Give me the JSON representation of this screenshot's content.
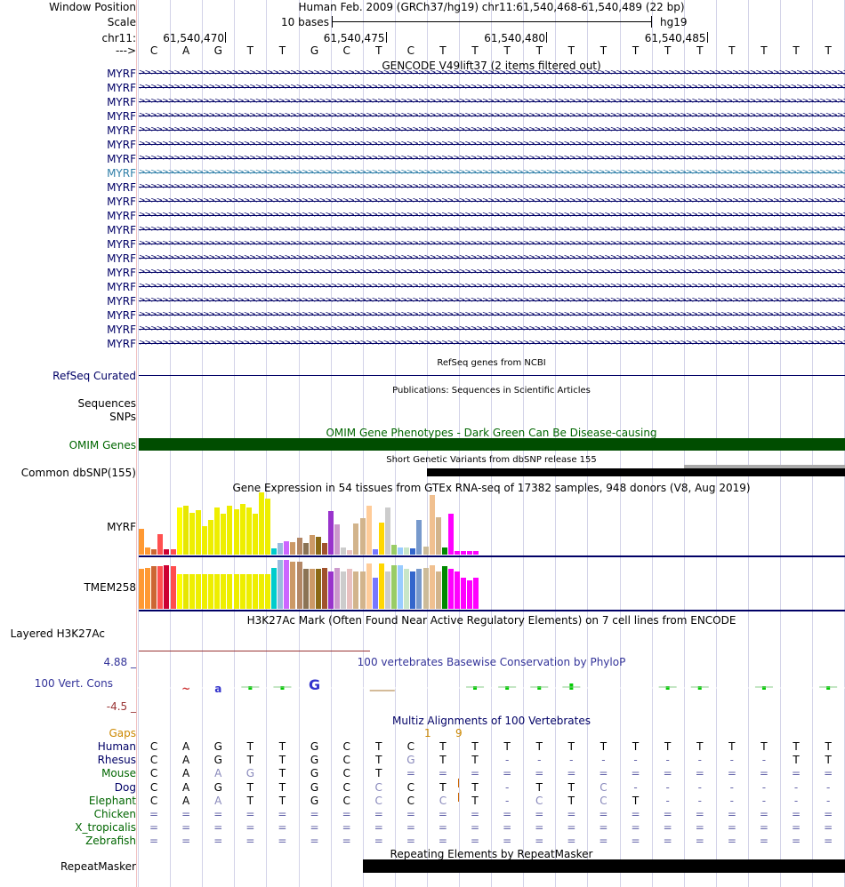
{
  "header": {
    "window_position_label": "Window Position",
    "scale_label": "Scale",
    "chrom_label": "chr11:",
    "strand_label": "--->",
    "assembly_title": "Human Feb. 2009 (GRCh37/hg19)   chr11:61,540,468-61,540,489 (22 bp)",
    "scale_text": "10 bases",
    "scale_assembly": "hg19",
    "ruler_positions": [
      "61,540,470",
      "61,540,475",
      "61,540,480",
      "61,540,485"
    ]
  },
  "sequence": [
    "C",
    "A",
    "G",
    "T",
    "T",
    "G",
    "C",
    "T",
    "C",
    "T",
    "T",
    "T",
    "T",
    "T",
    "T",
    "T",
    "T",
    "T",
    "T",
    "T",
    "T",
    "T"
  ],
  "gencode": {
    "title": "GENCODE V49lift37 (2 items filtered out)",
    "rows": [
      "MYRF",
      "MYRF",
      "MYRF",
      "MYRF",
      "MYRF",
      "MYRF",
      "MYRF",
      "MYRF",
      "MYRF",
      "MYRF",
      "MYRF",
      "MYRF",
      "MYRF",
      "MYRF",
      "MYRF",
      "MYRF",
      "MYRF",
      "MYRF",
      "MYRF",
      "MYRF"
    ],
    "highlight_index": 7
  },
  "refseq": {
    "title": "RefSeq genes from NCBI",
    "label": "RefSeq Curated"
  },
  "publications": {
    "title": "Publications: Sequences in Scientific Articles",
    "label1": "Sequences",
    "label2": "SNPs"
  },
  "omim": {
    "title": "OMIM Gene Phenotypes - Dark Green Can Be Disease-causing",
    "label": "OMIM Genes",
    "color": "#004d00"
  },
  "dbsnp": {
    "title": "Short Genetic Variants from dbSNP release 155",
    "label": "Common dbSNP(155)"
  },
  "gtex": {
    "title": "Gene Expression in 54 tissues from GTEx RNA-seq of 17382 samples, 948 donors (V8, Aug 2019)",
    "genes": [
      {
        "name": "MYRF",
        "values": [
          0.42,
          0.12,
          0.08,
          0.33,
          0.08,
          0.08,
          0.75,
          0.78,
          0.67,
          0.72,
          0.45,
          0.55,
          0.76,
          0.65,
          0.78,
          0.73,
          0.82,
          0.75,
          0.66,
          1.0,
          0.9,
          0.1,
          0.18,
          0.22,
          0.2,
          0.27,
          0.18,
          0.32,
          0.28,
          0.18,
          0.7,
          0.48,
          0.12,
          0.07,
          0.5,
          0.58,
          0.78,
          0.08,
          0.52,
          0.75,
          0.15,
          0.12,
          0.12,
          0.1,
          0.55,
          0.13,
          0.95,
          0.6,
          0.12,
          0.65,
          0.05,
          0.05,
          0.05,
          0.05
        ]
      },
      {
        "name": "TMEM258",
        "values": [
          0.78,
          0.8,
          0.82,
          0.82,
          0.85,
          0.82,
          0.68,
          0.68,
          0.68,
          0.68,
          0.68,
          0.68,
          0.68,
          0.68,
          0.68,
          0.68,
          0.68,
          0.68,
          0.68,
          0.68,
          0.68,
          0.8,
          0.95,
          0.95,
          0.92,
          0.92,
          0.78,
          0.78,
          0.78,
          0.8,
          0.72,
          0.8,
          0.72,
          0.78,
          0.72,
          0.72,
          0.88,
          0.6,
          0.88,
          0.72,
          0.85,
          0.85,
          0.78,
          0.72,
          0.78,
          0.8,
          0.85,
          0.72,
          0.82,
          0.78,
          0.72,
          0.6,
          0.55,
          0.6
        ]
      }
    ],
    "colors": [
      "#ff9933",
      "#ff9933",
      "#cc6633",
      "#ff5050",
      "#cc0033",
      "#ff4d4d",
      "#ffff00",
      "#e6e600",
      "#eeee00",
      "#eeee00",
      "#eeee00",
      "#eeee00",
      "#eeee00",
      "#eeee00",
      "#eeee00",
      "#eeee00",
      "#eeee00",
      "#eeee00",
      "#eeee00",
      "#eeee00",
      "#eeee00",
      "#00cccc",
      "#99bbdd",
      "#cc66ff",
      "#cc9966",
      "#b38766",
      "#8b7355",
      "#cc9966",
      "#8b6914",
      "#a0522d",
      "#9933cc",
      "#cc99cc",
      "#cccccc",
      "#e8c0c0",
      "#d2b48c",
      "#d2b48c",
      "#ffcc99",
      "#7777ff",
      "#ffd700",
      "#cccccc",
      "#99cc66",
      "#99ccff",
      "#c8e6c8",
      "#3366cc",
      "#7799cc",
      "#ccbb99",
      "#f0c090",
      "#d2b48c",
      "#008800",
      "#ff00ff",
      "#ff00ff",
      "#ff00ff",
      "#ff00ff",
      "#ff00ff"
    ]
  },
  "h3k27ac": {
    "title": "H3K27Ac Mark (Often Found Near Active Regulatory Elements) on 7 cell lines from ENCODE",
    "label": "Layered H3K27Ac"
  },
  "conservation": {
    "title": "100 vertebrates Basewise Conservation by PhyloP",
    "label": "100 Vert. Cons",
    "max": "4.88 _",
    "min": "-4.5 _"
  },
  "multiz": {
    "title": "Multiz Alignments of 100 Vertebrates",
    "gaps_label": "Gaps",
    "gap_marks": [
      "1",
      "9"
    ],
    "species": [
      {
        "name": "Human",
        "color": "#000066",
        "bases": [
          "C",
          "A",
          "G",
          "T",
          "T",
          "G",
          "C",
          "T",
          "C",
          "T",
          "T",
          "T",
          "T",
          "T",
          "T",
          "T",
          "T",
          "T",
          "T",
          "T",
          "T",
          "T"
        ]
      },
      {
        "name": "Rhesus",
        "color": "#000066",
        "bases": [
          "C",
          "A",
          "G",
          "T",
          "T",
          "G",
          "C",
          "T",
          "G",
          "T",
          "T",
          "-",
          "-",
          "-",
          "-",
          "-",
          "-",
          "-",
          "-",
          "-",
          "T",
          "T"
        ]
      },
      {
        "name": "Mouse",
        "color": "#006600",
        "bases": [
          "C",
          "A",
          "A",
          "G",
          "T",
          "G",
          "C",
          "T",
          "=",
          "=",
          "=",
          "=",
          "=",
          "=",
          "=",
          "=",
          "=",
          "=",
          "=",
          "=",
          "=",
          "="
        ]
      },
      {
        "name": "Dog",
        "color": "#000066",
        "bases": [
          "C",
          "A",
          "G",
          "T",
          "T",
          "G",
          "C",
          "C",
          "C",
          "T",
          "T",
          "-",
          "T",
          "T",
          "C",
          "-",
          "-",
          "-",
          "-",
          "-",
          "-",
          "-"
        ]
      },
      {
        "name": "Elephant",
        "color": "#006600",
        "bases": [
          "C",
          "A",
          "A",
          "T",
          "T",
          "G",
          "C",
          "C",
          "C",
          "C",
          "T",
          "-",
          "C",
          "T",
          "C",
          "T",
          "-",
          "-",
          "-",
          "-",
          "-",
          "-"
        ]
      },
      {
        "name": "Chicken",
        "color": "#006600",
        "bases": [
          "=",
          "=",
          "=",
          "=",
          "=",
          "=",
          "=",
          "=",
          "=",
          "=",
          "=",
          "=",
          "=",
          "=",
          "=",
          "=",
          "=",
          "=",
          "=",
          "=",
          "=",
          "="
        ]
      },
      {
        "name": "X_tropicalis",
        "color": "#006600",
        "bases": [
          "=",
          "=",
          "=",
          "=",
          "=",
          "=",
          "=",
          "=",
          "=",
          "=",
          "=",
          "=",
          "=",
          "=",
          "=",
          "=",
          "=",
          "=",
          "=",
          "=",
          "=",
          "="
        ]
      },
      {
        "name": "Zebrafish",
        "color": "#006600",
        "bases": [
          "=",
          "=",
          "=",
          "=",
          "=",
          "=",
          "=",
          "=",
          "=",
          "=",
          "=",
          "=",
          "=",
          "=",
          "=",
          "=",
          "=",
          "=",
          "=",
          "=",
          "=",
          "="
        ]
      }
    ]
  },
  "repeatmasker": {
    "title": "Repeating Elements by RepeatMasker",
    "label": "RepeatMasker"
  }
}
